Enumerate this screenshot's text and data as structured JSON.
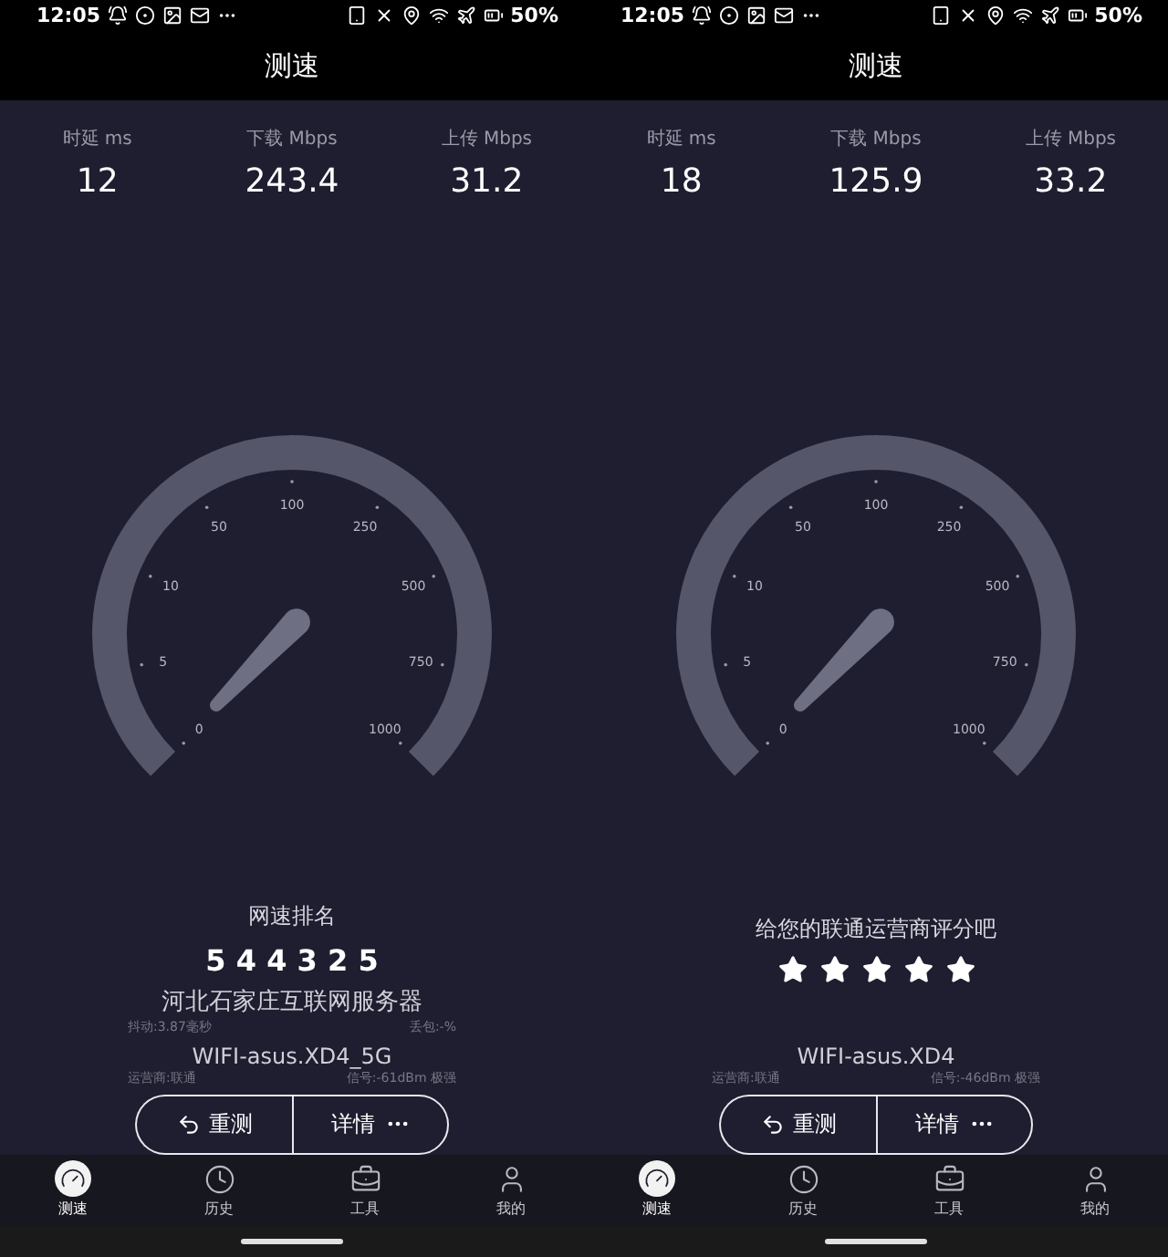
{
  "panels": [
    {
      "status_bar": {
        "time": "12:05",
        "battery": "50%"
      },
      "title": "测速",
      "stats": [
        {
          "label": "时延 ms",
          "value": "12"
        },
        {
          "label": "下载 Mbps",
          "value": "243.4"
        },
        {
          "label": "上传 Mbps",
          "value": "31.2"
        }
      ],
      "gauge": {
        "ticks": [
          "0",
          "5",
          "10",
          "50",
          "100",
          "250",
          "500",
          "750",
          "1000"
        ]
      },
      "feedback": {
        "kind": "ranking",
        "title": "网速排名",
        "digits": "5 4 4 3 2 5",
        "server": "河北石家庄互联网服务器",
        "jitter": "抖动:3.87毫秒",
        "packet_loss": "丢包:-%"
      },
      "wifi": {
        "name": "WIFI-asus.XD4_5G",
        "carrier": "运营商:联通",
        "signal": "信号:-61dBm 极强"
      },
      "buttons": [
        "重测",
        "详情"
      ],
      "nav": [
        {
          "label": "测速",
          "selected": true
        },
        {
          "label": "历史",
          "selected": false
        },
        {
          "label": "工具",
          "selected": false
        },
        {
          "label": "我的",
          "selected": false
        }
      ]
    },
    {
      "status_bar": {
        "time": "12:05",
        "battery": "50%"
      },
      "title": "测速",
      "stats": [
        {
          "label": "时延 ms",
          "value": "18"
        },
        {
          "label": "下载 Mbps",
          "value": "125.9"
        },
        {
          "label": "上传 Mbps",
          "value": "33.2"
        }
      ],
      "gauge": {
        "ticks": [
          "0",
          "5",
          "10",
          "50",
          "100",
          "250",
          "500",
          "750",
          "1000"
        ]
      },
      "feedback": {
        "kind": "rating",
        "prompt": "给您的联通运营商评分吧",
        "stars": 5
      },
      "wifi": {
        "name": "WIFI-asus.XD4",
        "carrier": "运营商:联通",
        "signal": "信号:-46dBm 极强"
      },
      "buttons": [
        "重测",
        "详情"
      ],
      "nav": [
        {
          "label": "测速",
          "selected": true
        },
        {
          "label": "历史",
          "selected": false
        },
        {
          "label": "工具",
          "selected": false
        },
        {
          "label": "我的",
          "selected": false
        }
      ]
    }
  ]
}
